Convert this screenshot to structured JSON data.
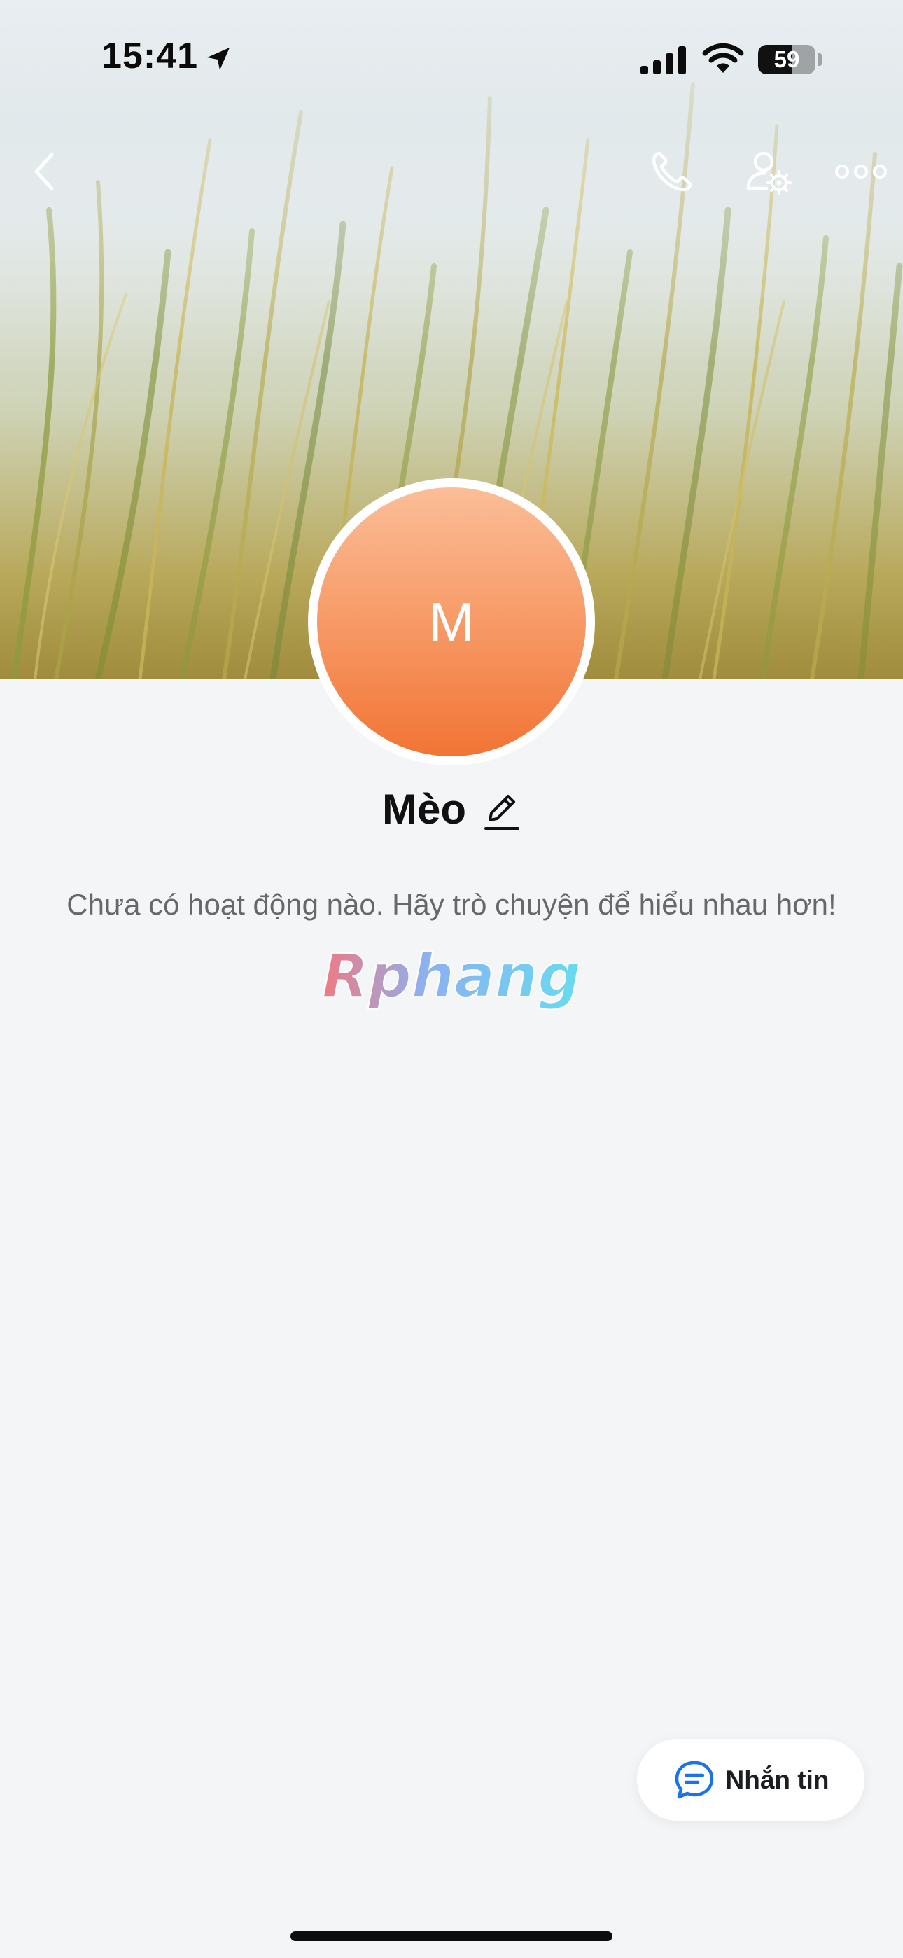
{
  "status_bar": {
    "time": "15:41",
    "battery_percent": "59",
    "battery_level": 0.59
  },
  "header": {
    "back_icon": "chevron-left-icon",
    "call_icon": "phone-icon",
    "settings_icon": "user-settings-icon",
    "more_icon": "more-horizontal-icon"
  },
  "profile": {
    "avatar_initial": "M",
    "name": "Mèo",
    "avatar_colors": [
      "#fbbd97",
      "#f27435"
    ]
  },
  "timeline": {
    "empty_message": "Chưa có hoạt động nào. Hãy trò chuyện để hiểu nhau hơn!"
  },
  "watermark": {
    "text": "Rphang"
  },
  "actions": {
    "message_label": "Nhắn tin",
    "message_icon": "chat-bubble-icon",
    "accent": "#1a73e8"
  }
}
